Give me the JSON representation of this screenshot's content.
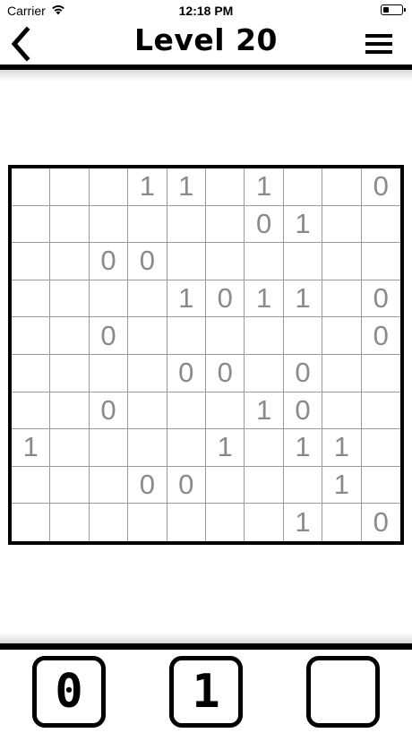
{
  "status_bar": {
    "carrier": "Carrier",
    "time": "12:18 PM"
  },
  "nav": {
    "title": "Level 20",
    "back_icon": "chevron-left-icon",
    "menu_icon": "hamburger-menu-icon"
  },
  "board": {
    "size": 10,
    "rows": [
      [
        "",
        "",
        "",
        "1",
        "1",
        "",
        "1",
        "",
        "",
        "0"
      ],
      [
        "",
        "",
        "",
        "",
        "",
        "",
        "0",
        "1",
        "",
        ""
      ],
      [
        "",
        "",
        "0",
        "0",
        "",
        "",
        "",
        "",
        "",
        ""
      ],
      [
        "",
        "",
        "",
        "",
        "1",
        "0",
        "1",
        "1",
        "",
        "0"
      ],
      [
        "",
        "",
        "0",
        "",
        "",
        "",
        "",
        "",
        "",
        "0"
      ],
      [
        "",
        "",
        "",
        "",
        "0",
        "0",
        "",
        "0",
        "",
        ""
      ],
      [
        "",
        "",
        "0",
        "",
        "",
        "",
        "1",
        "0",
        "",
        ""
      ],
      [
        "1",
        "",
        "",
        "",
        "",
        "1",
        "",
        "1",
        "1",
        ""
      ],
      [
        "",
        "",
        "",
        "0",
        "0",
        "",
        "",
        "",
        "1",
        ""
      ],
      [
        "",
        "",
        "",
        "",
        "",
        "",
        "",
        "1",
        "",
        "0"
      ]
    ]
  },
  "keys": {
    "zero": "0",
    "one": "1",
    "blank": ""
  },
  "colors": {
    "given_digit": "#8a8a8a",
    "grid_line": "#9a9a9a",
    "border": "#000000"
  }
}
